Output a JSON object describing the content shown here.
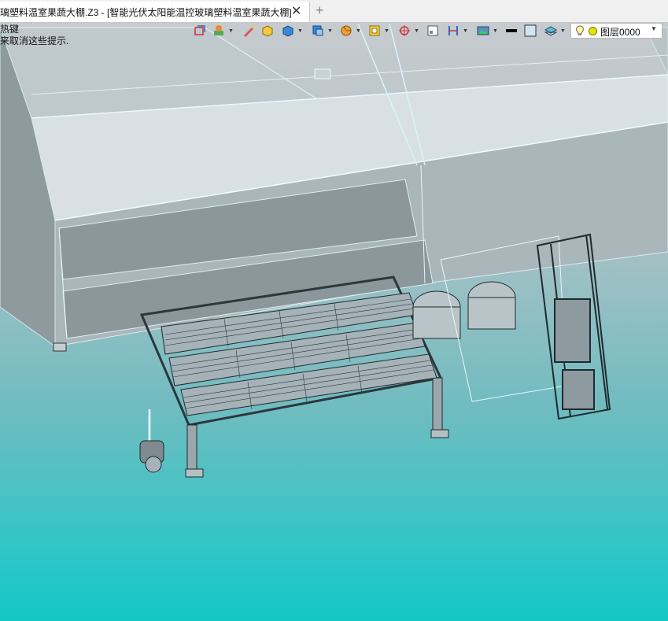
{
  "window": {
    "tab_title": "璃塑料温室果蔬大棚.Z3 - [智能光伏太阳能温控玻璃塑料温室果蔬大棚]",
    "tab_close_icon": "close-icon",
    "new_tab_icon": "plus-icon"
  },
  "hint": {
    "line1": "热键",
    "line2": "来取消这些提示."
  },
  "toolbar": {
    "items": [
      "undo-view-icon",
      "paint-icon",
      "pencil-icon",
      "box-icon",
      "cube-icon",
      "solid-icon",
      "pie-icon",
      "frame-icon",
      "target-icon",
      "plane-icon",
      "dimension-icon",
      "image-icon",
      "line-color-icon",
      "fill-color-icon",
      "layers-icon"
    ],
    "layer": {
      "bulb_icon": "lightbulb-icon",
      "color_icon": "layer-color-icon",
      "name": "图层0000"
    }
  },
  "colors": {
    "greenhouse": "#8fa3a8",
    "equipment": "#3c4a52",
    "highlight": "#e6f4ff",
    "background_bottom": "#15c6c7"
  }
}
